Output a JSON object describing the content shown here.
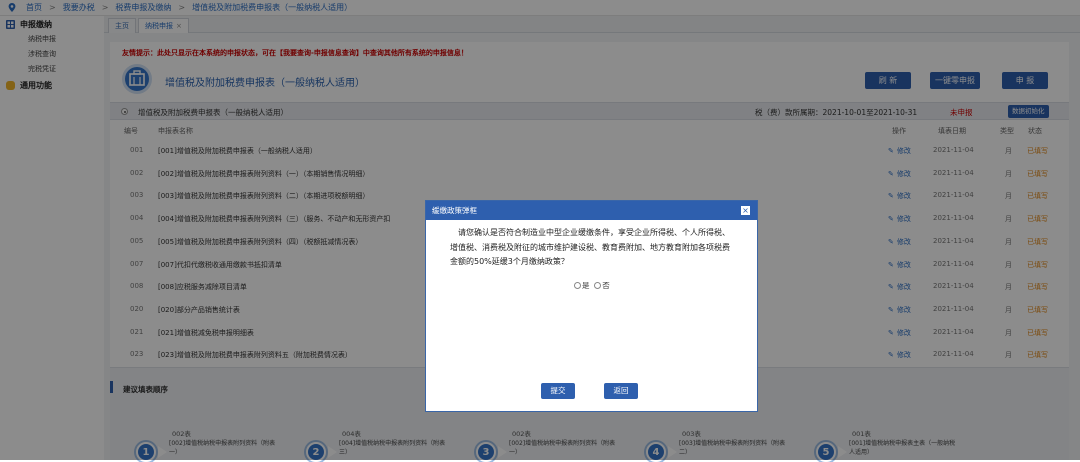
{
  "breadcrumb": [
    "首页",
    "我要办税",
    "税费申报及缴纳",
    "增值税及附加税费申报表（一般纳税人适用）"
  ],
  "sidebar": {
    "group1": {
      "label": "申报缴纳",
      "items": [
        "纳税申报",
        "涉税查询",
        "完税凭证"
      ]
    },
    "group2": {
      "label": "通用功能"
    }
  },
  "tabs": [
    {
      "label": "主页"
    },
    {
      "label": "纳税申报",
      "close": "×"
    }
  ],
  "warning": "友情提示：此处只显示在本系统的申报状态，可在【我要查询-申报信息查询】中查询其他所有系统的申报信息！",
  "header": {
    "title": "增值税及附加税费申报表（一般纳税人适用）",
    "refresh": "刷 新",
    "zero_declare": "一键零申报",
    "declare": "申 报"
  },
  "section": {
    "title": "增值税及附加税费申报表（一般纳税人适用）",
    "period": "税（费）款所属期：2021-10-01至2021-10-31",
    "status": "未申报",
    "init_button": "数据初始化"
  },
  "table": {
    "headers": {
      "num": "编号",
      "name": "申报表名称",
      "op": "操作",
      "date": "填表日期",
      "type": "类型",
      "status": "状态"
    },
    "rows": [
      {
        "num": "001",
        "name": "[001]增值税及附加税费申报表（一般纳税人适用）",
        "op": "修改",
        "date": "2021-11-04",
        "type": "月",
        "status": "已填写"
      },
      {
        "num": "002",
        "name": "[002]增值税及附加税费申报表附列资料（一）（本期销售情况明细）",
        "op": "修改",
        "date": "2021-11-04",
        "type": "月",
        "status": "已填写"
      },
      {
        "num": "003",
        "name": "[003]增值税及附加税费申报表附列资料（二）（本期进项税额明细）",
        "op": "修改",
        "date": "2021-11-04",
        "type": "月",
        "status": "已填写"
      },
      {
        "num": "004",
        "name": "[004]增值税及附加税费申报表附列资料（三）（服务、不动产和无形资产扣",
        "op": "修改",
        "date": "2021-11-04",
        "type": "月",
        "status": "已填写"
      },
      {
        "num": "005",
        "name": "[005]增值税及附加税费申报表附列资料（四）（税额抵减情况表）",
        "op": "修改",
        "date": "2021-11-04",
        "type": "月",
        "status": "已填写"
      },
      {
        "num": "007",
        "name": "[007]代扣代缴税收通用缴款书抵扣清单",
        "op": "修改",
        "date": "2021-11-04",
        "type": "月",
        "status": "已填写"
      },
      {
        "num": "008",
        "name": "[008]应税服务减除项目清单",
        "op": "修改",
        "date": "2021-11-04",
        "type": "月",
        "status": "已填写"
      },
      {
        "num": "020",
        "name": "[020]部分产品销售统计表",
        "op": "修改",
        "date": "2021-11-04",
        "type": "月",
        "status": "已填写"
      },
      {
        "num": "021",
        "name": "[021]增值税减免税申报明细表",
        "op": "修改",
        "date": "2021-11-04",
        "type": "月",
        "status": "已填写"
      },
      {
        "num": "023",
        "name": "[023]增值税及附加税费申报表附列资料五（附加税费情况表）",
        "op": "修改",
        "date": "2021-11-04",
        "type": "月",
        "status": "已填写"
      }
    ]
  },
  "suggest": {
    "title": "建议填表顺序",
    "steps": [
      {
        "n": "1",
        "code": "002表",
        "name": "[002]增值税纳税申报表附列资料（附表一）"
      },
      {
        "n": "2",
        "code": "004表",
        "name": "[004]增值税纳税申报表附列资料（附表三）"
      },
      {
        "n": "3",
        "code": "002表",
        "name": "[002]增值税纳税申报表附列资料（附表一）"
      },
      {
        "n": "4",
        "code": "003表",
        "name": "[003]增值税纳税申报表附列资料（附表二）"
      },
      {
        "n": "5",
        "code": "001表",
        "name": "[001]增值税纳税申报表主表（一般纳税人适用）"
      }
    ]
  },
  "modal": {
    "title": "缓缴政策弹框",
    "close": "×",
    "question": "请您确认是否符合制造业中型企业缓缴条件，享受企业所得税、个人所得税、增值税、消费税及附征的城市维护建设税、教育费附加、地方教育附加各项税费金额的50%延缓3个月缴纳政策？",
    "yes": "是",
    "no": "否",
    "submit": "提交",
    "back": "返回"
  }
}
